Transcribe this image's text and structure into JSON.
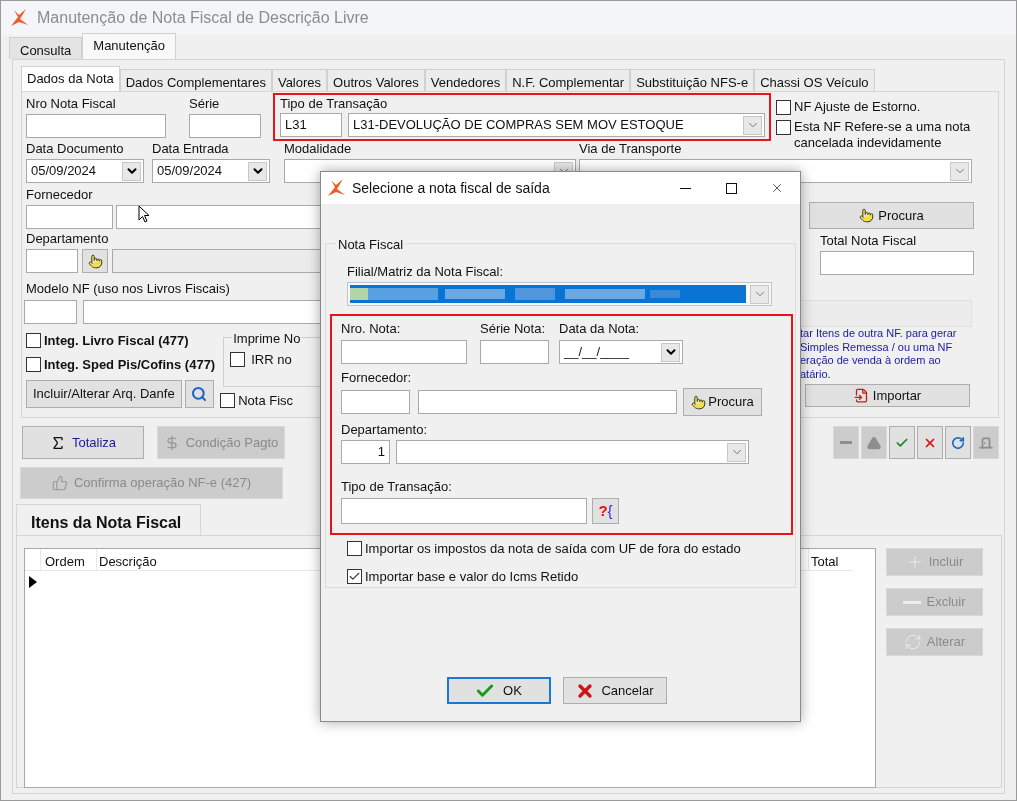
{
  "window": {
    "title": "Manutenção de Nota Fiscal de Descrição Livre"
  },
  "tabs": [
    {
      "label": "Consulta",
      "selected": false
    },
    {
      "label": "Manutenção",
      "selected": true
    }
  ],
  "subtabs": [
    {
      "label": "Dados da Nota",
      "selected": true
    },
    {
      "label": "Dados Complementares",
      "selected": false
    },
    {
      "label": "Valores",
      "selected": false
    },
    {
      "label": "Outros Valores",
      "selected": false
    },
    {
      "label": "Vendedores",
      "selected": false
    },
    {
      "label": "N.F. Complementar",
      "selected": false
    },
    {
      "label": "Substituição NFS-e",
      "selected": false
    },
    {
      "label": "Chassi OS Veículo",
      "selected": false
    }
  ],
  "form": {
    "nro_nota": {
      "label": "Nro Nota Fiscal"
    },
    "serie": {
      "label": "Série"
    },
    "tipo_transacao": {
      "label": "Tipo de Transação",
      "code": "L31",
      "value": "L31-DEVOLUÇÃO DE COMPRAS SEM MOV ESTOQUE"
    },
    "flags": [
      {
        "label": "NF Ajuste de Estorno.",
        "checked": false
      },
      {
        "label": "Esta NF Refere-se a uma nota cancelada indevidamente",
        "checked": false
      }
    ],
    "data_documento": {
      "label": "Data Documento",
      "value": "05/09/2024"
    },
    "data_entrada": {
      "label": "Data Entrada",
      "value": "05/09/2024"
    },
    "modalidade": {
      "label": "Modalidade"
    },
    "via_transporte": {
      "label": "Via de Transporte"
    },
    "fornecedor": {
      "label": "Fornecedor"
    },
    "procura_button": "Procura",
    "departamento": {
      "label": "Departamento"
    },
    "total": {
      "label": "Total Nota Fiscal"
    },
    "modelo_nf": {
      "label": "Modelo NF (uso nos Livros Fiscais)"
    },
    "integ": [
      {
        "label": "Integ. Livro Fiscal (477)",
        "checked": false
      },
      {
        "label": "Integ. Sped Pis/Cofins (477)",
        "checked": false
      }
    ],
    "imprime_group": {
      "title": "Imprime No",
      "option": {
        "label": "IRR no",
        "checked": false
      }
    },
    "danfe_button": "Incluir/Alterar Arq. Danfe",
    "nota_fisc": {
      "label": "Nota Fisc",
      "checked": false
    },
    "import_hint": [
      "tar Itens de outra NF. para gerar",
      "Simples Remessa / ou uma NF",
      "eração de venda à ordem ao",
      "atário."
    ],
    "importar_button": "Importar"
  },
  "actions": [
    {
      "label": "Totaliza",
      "disabled": false,
      "kind": "sum"
    },
    {
      "label": "Condição Pagto",
      "disabled": true,
      "kind": "dollar"
    }
  ],
  "confirm_button": {
    "label": "Confirma operação NF-e (427)",
    "disabled": true
  },
  "toolbar": [
    {
      "kind": "minus",
      "disabled": true
    },
    {
      "kind": "up",
      "disabled": true
    },
    {
      "kind": "check",
      "disabled": false
    },
    {
      "kind": "cross",
      "disabled": false
    },
    {
      "kind": "redo",
      "disabled": false
    },
    {
      "kind": "door",
      "disabled": true
    }
  ],
  "items": {
    "tab": "Itens da Nota Fiscal",
    "columns": [
      "Ordem",
      "Descrição",
      "Total"
    ],
    "buttons": [
      {
        "label": "Incluir",
        "disabled": true,
        "kind": "plus"
      },
      {
        "label": "Excluir",
        "disabled": true,
        "kind": "minus"
      },
      {
        "label": "Alterar",
        "disabled": true,
        "kind": "refresh"
      }
    ]
  },
  "dialog": {
    "title": "Selecione a nota fiscal de saída",
    "group": "Nota Fiscal",
    "filial_label": "Filial/Matriz da Nota Fiscal:",
    "nro_label": "Nro. Nota:",
    "serie_label": "Série Nota:",
    "data_label": "Data da Nota:",
    "data_value": "__/__/____",
    "fornecedor_label": "Fornecedor:",
    "procura": "Procura",
    "departamento_label": "Departamento:",
    "departamento_code": "1",
    "tipo_label": "Tipo de Transação:",
    "lookup_mark": "?",
    "lookup_brace": "{",
    "options": [
      {
        "label": "Importar os impostos da nota de saída com UF de fora do estado",
        "checked": false
      },
      {
        "label": "Importar base e valor do Icms Retido",
        "checked": true
      }
    ],
    "ok": "OK",
    "cancel": "Cancelar"
  }
}
